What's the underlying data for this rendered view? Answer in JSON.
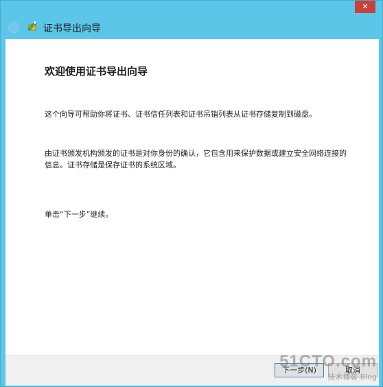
{
  "window": {
    "title": "证书导出向导",
    "close_label": "✕"
  },
  "content": {
    "heading": "欢迎使用证书导出向导",
    "paragraph1": "这个向导可帮助你将证书、证书信任列表和证书吊销列表从证书存储复制到磁盘。",
    "paragraph2": "由证书颁发机构颁发的证书是对你身份的确认，它包含用来保护数据或建立安全网络连接的信息。证书存储是保存证书的系统区域。",
    "paragraph3": "单击“下一步”继续。"
  },
  "footer": {
    "next_label": "下一步(N)",
    "cancel_label": "取消"
  },
  "watermark": {
    "site": "51CTO.com",
    "sub": "技术博客  Blog"
  },
  "colors": {
    "frame": "#5cc6e8",
    "close": "#c8413a",
    "content_bg": "#ffffff",
    "footer_bg": "#f0f0f0"
  }
}
